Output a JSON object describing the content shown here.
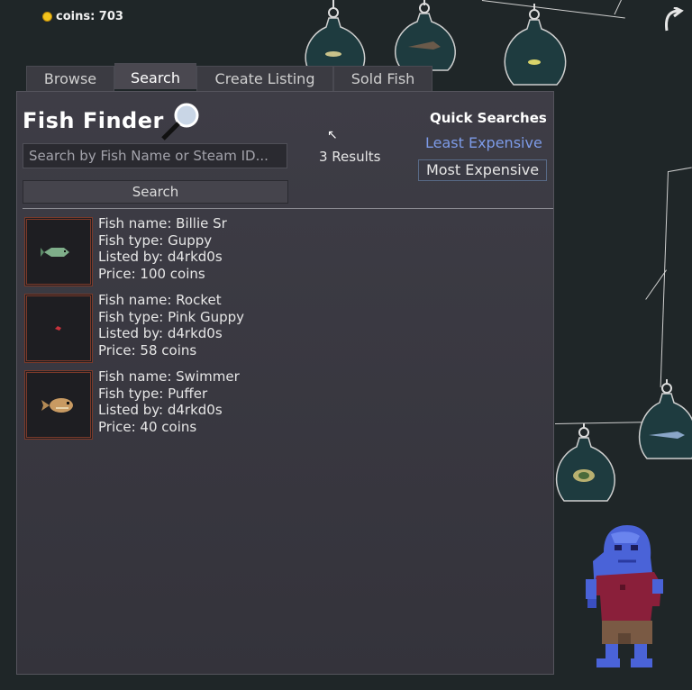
{
  "hud": {
    "coins_label": "coins: 703"
  },
  "tabs": [
    {
      "label": "Browse",
      "active": false
    },
    {
      "label": "Search",
      "active": true
    },
    {
      "label": "Create Listing",
      "active": false
    },
    {
      "label": "Sold Fish",
      "active": false
    }
  ],
  "finder": {
    "title": "Fish Finder",
    "search_placeholder": "Search by Fish Name or Steam ID...",
    "search_button": "Search",
    "results_text": "3 Results",
    "quick_searches_title": "Quick Searches",
    "least_expensive": "Least Expensive",
    "most_expensive": "Most Expensive"
  },
  "listings": [
    {
      "name": "Fish name: Billie Sr",
      "type": "Fish type: Guppy",
      "seller": "Listed by: d4rkd0s",
      "price": "Price: 100 coins",
      "fish_icon": "guppy-icon"
    },
    {
      "name": "Fish name: Rocket",
      "type": "Fish type: Pink Guppy",
      "seller": "Listed by: d4rkd0s",
      "price": "Price: 58 coins",
      "fish_icon": "pink-guppy-icon"
    },
    {
      "name": "Fish name: Swimmer",
      "type": "Fish type: Puffer",
      "seller": "Listed by: d4rkd0s",
      "price": "Price: 40 coins",
      "fish_icon": "puffer-icon"
    }
  ],
  "colors": {
    "background": "#1f2628",
    "panel": "#3e3d46",
    "link": "#7d9be8",
    "coin": "#f2c31c",
    "thumb_border": "#7b3a2a"
  }
}
